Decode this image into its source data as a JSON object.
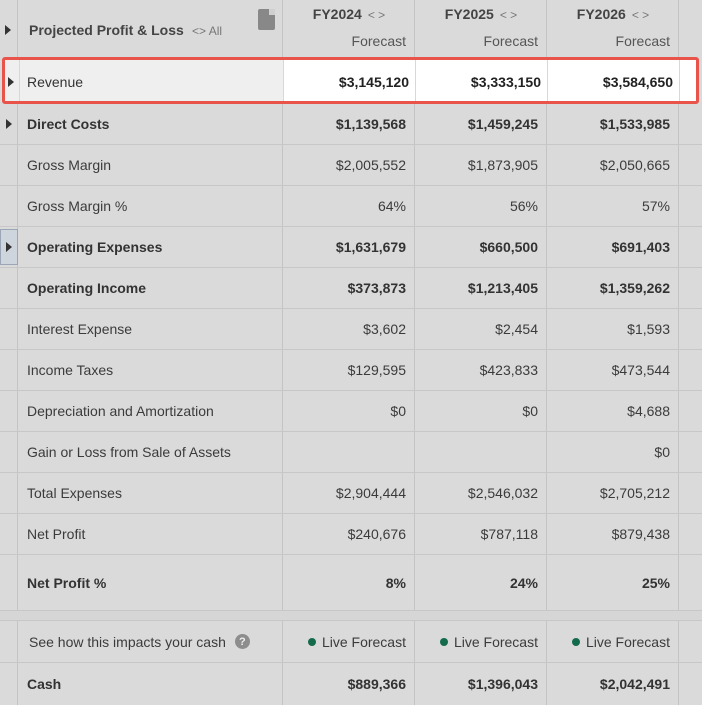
{
  "header": {
    "title": "Projected Profit & Loss",
    "all_label": "All",
    "all_arrows": "<>",
    "columns": [
      {
        "year": "FY2024",
        "arrows": "< >",
        "sub": "Forecast"
      },
      {
        "year": "FY2025",
        "arrows": "< >",
        "sub": "Forecast"
      },
      {
        "year": "FY2026",
        "arrows": "< >",
        "sub": "Forecast"
      }
    ]
  },
  "rows": [
    {
      "label": "Revenue",
      "values": [
        "$3,145,120",
        "$3,333,150",
        "$3,584,650"
      ],
      "expandable": true,
      "bold": false,
      "highlighted": true
    },
    {
      "label": "Direct Costs",
      "values": [
        "$1,139,568",
        "$1,459,245",
        "$1,533,985"
      ],
      "expandable": true,
      "bold": true
    },
    {
      "label": "Gross Margin",
      "values": [
        "$2,005,552",
        "$1,873,905",
        "$2,050,665"
      ],
      "expandable": false,
      "bold": false
    },
    {
      "label": "Gross Margin %",
      "values": [
        "64%",
        "56%",
        "57%"
      ],
      "expandable": false,
      "bold": false
    },
    {
      "label": "Operating Expenses",
      "values": [
        "$1,631,679",
        "$660,500",
        "$691,403"
      ],
      "expandable": true,
      "bold": true
    },
    {
      "label": "Operating Income",
      "values": [
        "$373,873",
        "$1,213,405",
        "$1,359,262"
      ],
      "expandable": false,
      "bold": true
    },
    {
      "label": "Interest Expense",
      "values": [
        "$3,602",
        "$2,454",
        "$1,593"
      ],
      "expandable": false,
      "bold": false
    },
    {
      "label": "Income Taxes",
      "values": [
        "$129,595",
        "$423,833",
        "$473,544"
      ],
      "expandable": false,
      "bold": false
    },
    {
      "label": "Depreciation and Amortization",
      "values": [
        "$0",
        "$0",
        "$4,688"
      ],
      "expandable": false,
      "bold": false
    },
    {
      "label": "Gain or Loss from Sale of Assets",
      "values": [
        "",
        "",
        "$0"
      ],
      "expandable": false,
      "bold": false
    },
    {
      "label": "Total Expenses",
      "values": [
        "$2,904,444",
        "$2,546,032",
        "$2,705,212"
      ],
      "expandable": false,
      "bold": false
    },
    {
      "label": "Net Profit",
      "values": [
        "$240,676",
        "$787,118",
        "$879,438"
      ],
      "expandable": false,
      "bold": false
    },
    {
      "label": "Net Profit %",
      "values": [
        "8%",
        "24%",
        "25%"
      ],
      "expandable": false,
      "bold": true
    }
  ],
  "cash_section": {
    "impact_label": "See how this impacts your cash",
    "help_icon": "?",
    "live_labels": [
      "Live Forecast",
      "Live Forecast",
      "Live Forecast"
    ],
    "cash_label": "Cash",
    "cash_values": [
      "$889,366",
      "$1,396,043",
      "$2,042,491"
    ]
  },
  "colors": {
    "highlight_border": "#e9544a",
    "live_dot": "#136b4c",
    "overlay": "#dadada"
  }
}
